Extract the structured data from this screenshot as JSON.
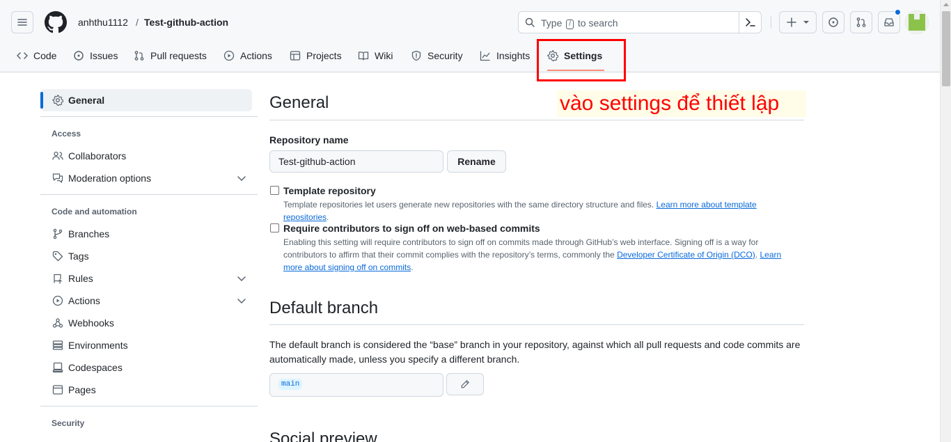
{
  "header": {
    "owner": "anhthu1112",
    "separator": "/",
    "repo": "Test-github-action",
    "search_prefix": "Type",
    "search_key": "/",
    "search_suffix": "to search"
  },
  "tabs": [
    {
      "label": "Code",
      "icon": "code-icon"
    },
    {
      "label": "Issues",
      "icon": "issue-icon"
    },
    {
      "label": "Pull requests",
      "icon": "pull-request-icon"
    },
    {
      "label": "Actions",
      "icon": "play-icon"
    },
    {
      "label": "Projects",
      "icon": "table-icon"
    },
    {
      "label": "Wiki",
      "icon": "book-icon"
    },
    {
      "label": "Security",
      "icon": "shield-icon"
    },
    {
      "label": "Insights",
      "icon": "graph-icon"
    },
    {
      "label": "Settings",
      "icon": "gear-icon",
      "active": true
    }
  ],
  "sidebar": {
    "general": "General",
    "access_heading": "Access",
    "collaborators": "Collaborators",
    "moderation": "Moderation options",
    "code_heading": "Code and automation",
    "branches": "Branches",
    "tags": "Tags",
    "rules": "Rules",
    "actions": "Actions",
    "webhooks": "Webhooks",
    "environments": "Environments",
    "codespaces": "Codespaces",
    "pages": "Pages",
    "security_heading": "Security"
  },
  "main": {
    "general_title": "General",
    "repo_name_label": "Repository name",
    "repo_name_value": "Test-github-action",
    "rename_button": "Rename",
    "template_title": "Template repository",
    "template_desc": "Template repositories let users generate new repositories with the same directory structure and files.",
    "template_link": "Learn more about template repositories",
    "signoff_title": "Require contributors to sign off on web-based commits",
    "signoff_desc_1": "Enabling this setting will require contributors to sign off on commits made through GitHub’s web interface. Signing off is a way for contributors to affirm that their commit complies with the repository’s terms, commonly the",
    "signoff_link_1": "Developer Certificate of Origin (DCO)",
    "signoff_link_2": "Learn more about signing off on commits",
    "default_branch_title": "Default branch",
    "default_branch_desc": "The default branch is considered the “base” branch in your repository, against which all pull requests and code commits are automatically made, unless you specify a different branch.",
    "branch_name": "main",
    "social_title": "Social preview"
  },
  "annotation": "vào settings để thiết lập",
  "colors": {
    "accent": "#0969da",
    "tab_underline": "#fd8c73",
    "annotation_red": "#ff0000"
  }
}
